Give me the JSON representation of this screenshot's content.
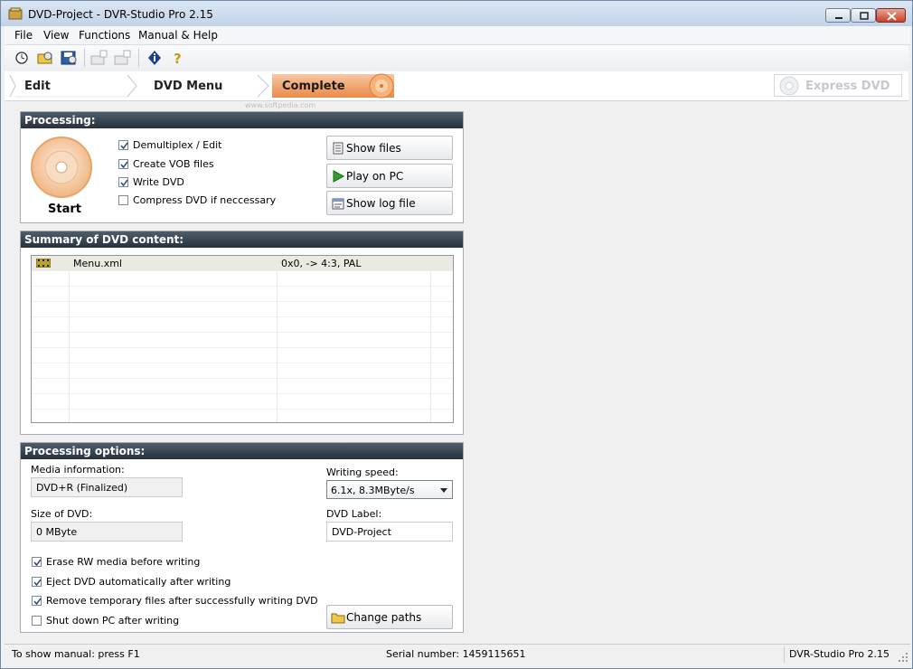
{
  "window": {
    "title": "DVD-Project - DVR-Studio Pro 2.15"
  },
  "menu": [
    "File",
    "View",
    "Functions",
    "Manual & Help"
  ],
  "toolbar": {
    "icons": [
      "clock-icon",
      "open-folder-icon",
      "save-icon",
      "add-folder-icon",
      "add-file-icon",
      "info-icon",
      "help-icon"
    ]
  },
  "steps": {
    "edit": "Edit",
    "dvd_menu": "DVD Menu",
    "complete": "Complete",
    "express": "Express DVD",
    "active": "Complete"
  },
  "processing": {
    "header": "Processing:",
    "start_label": "Start",
    "options": [
      {
        "label": "Demultiplex / Edit",
        "checked": true
      },
      {
        "label": "Create VOB files",
        "checked": true
      },
      {
        "label": "Write DVD",
        "checked": true
      },
      {
        "label": "Compress DVD if neccessary",
        "checked": false
      }
    ],
    "buttons": {
      "show_files": "Show files",
      "play_on_pc": "Play on PC",
      "show_log": "Show log file"
    }
  },
  "summary": {
    "header": "Summary of DVD content:",
    "rows": [
      {
        "name": "Menu.xml",
        "info": "0x0,  -> 4:3, PAL"
      }
    ]
  },
  "options": {
    "header": "Processing options:",
    "media_info_label": "Media information:",
    "media_info_value": "DVD+R (Finalized)",
    "size_label": "Size of DVD:",
    "size_value": "0 MByte",
    "writing_speed_label": "Writing speed:",
    "writing_speed_value": "6.1x, 8.3MByte/s",
    "dvd_label_label": "DVD Label:",
    "dvd_label_value": "DVD-Project",
    "checks": [
      {
        "label": "Erase RW media before writing",
        "checked": true
      },
      {
        "label": "Eject DVD automatically after writing",
        "checked": true
      },
      {
        "label": "Remove temporary files after successfully writing DVD",
        "checked": true
      },
      {
        "label": "Shut down PC after writing",
        "checked": false
      }
    ],
    "change_paths": "Change paths"
  },
  "status": {
    "left": "To show manual: press F1",
    "serial": "Serial number: 1459115651",
    "version": "DVR-Studio Pro 2.15"
  },
  "watermark": "www.softpedia.com",
  "colors": {
    "header_dark": "#26313c",
    "active_step": "#ea8a48",
    "checkmark": "#2b4a8a"
  }
}
